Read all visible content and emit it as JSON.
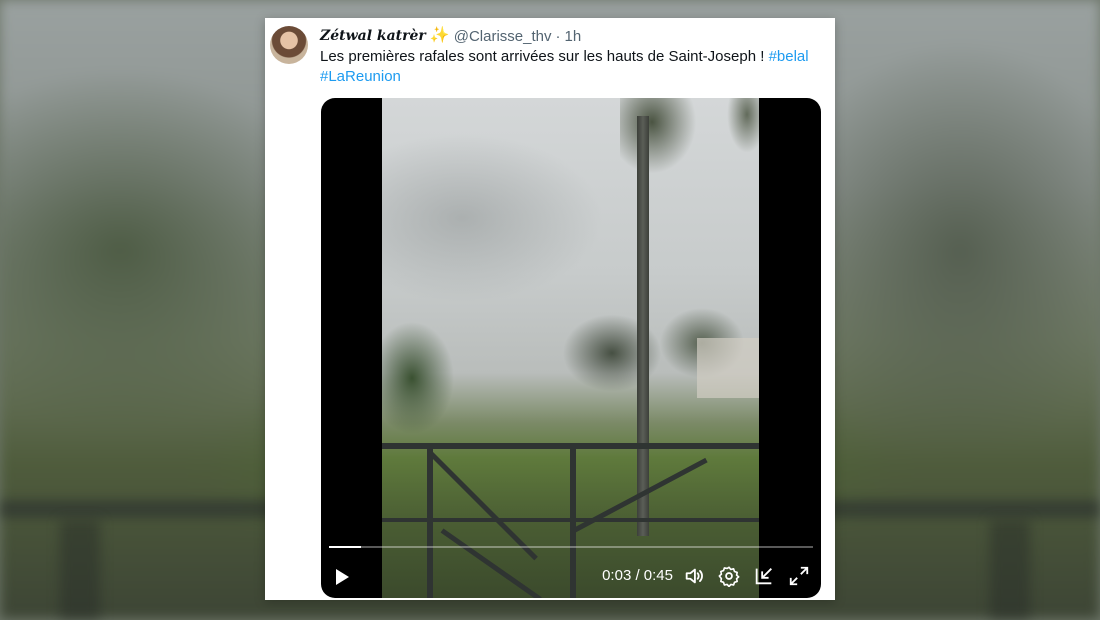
{
  "tweet": {
    "display_name": "Zétwal katrèr",
    "name_emoji": "✨",
    "handle": "@Clarisse_thv",
    "separator": "·",
    "time": "1h",
    "text": "Les premières rafales sont arrivées sur les hauts de Saint-Joseph ! ",
    "hashtags": [
      "#belal",
      "#LaReunion"
    ],
    "hashtag_color": "#1d9bf0"
  },
  "video": {
    "current_time": "0:03",
    "duration": "0:45",
    "time_display": "0:03 / 0:45",
    "progress_fraction": 0.0667,
    "icons": [
      "play-icon",
      "volume-icon",
      "settings-icon",
      "exit-fullscreen-icon",
      "fullscreen-icon"
    ]
  }
}
